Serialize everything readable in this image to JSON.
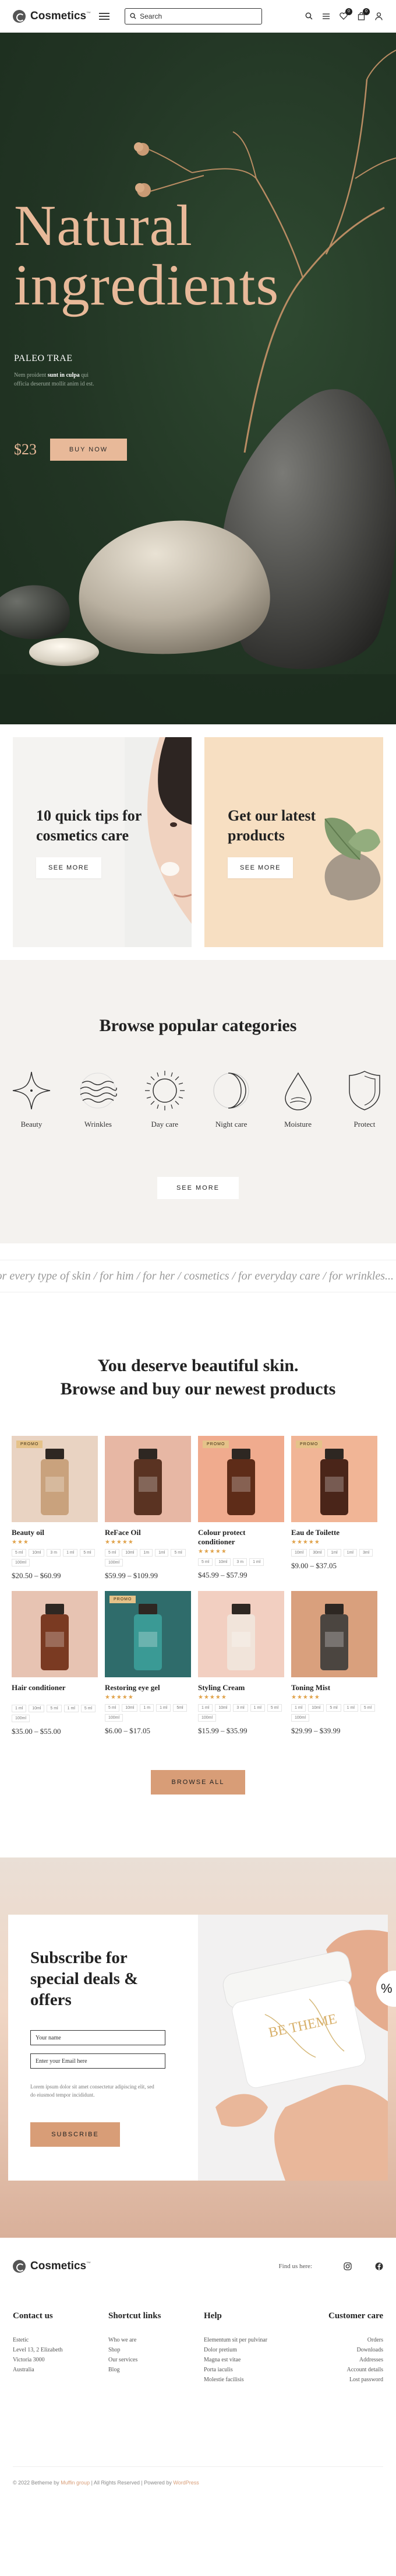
{
  "header": {
    "logo": "Cosmetics",
    "logo_tm": "™",
    "search_placeholder": "Search",
    "wishlist_count": "0",
    "cart_count": "0"
  },
  "hero": {
    "title_line1": "Natural",
    "title_line2": "ingredients",
    "subtitle": "PALEO TRAE",
    "desc_before": "Nem proident",
    "desc_bold": "sunt in culpa",
    "desc_after": "qui officia deserunt mollit anim id est.",
    "price": "$23",
    "button": "BUY NOW"
  },
  "promos": [
    {
      "title": "10 quick tips for cosmetics care",
      "button": "SEE MORE"
    },
    {
      "title": "Get our latest products",
      "button": "SEE MORE"
    }
  ],
  "categories": {
    "title": "Browse popular categories",
    "items": [
      {
        "label": "Beauty",
        "icon": "sparkle-icon"
      },
      {
        "label": "Wrinkles",
        "icon": "waves-icon"
      },
      {
        "label": "Day care",
        "icon": "sun-icon"
      },
      {
        "label": "Night care",
        "icon": "moon-icon"
      },
      {
        "label": "Moisture",
        "icon": "drop-icon"
      },
      {
        "label": "Protect",
        "icon": "shield-icon"
      }
    ],
    "button": "SEE MORE"
  },
  "marquee": "for every type of skin / for him / for her / cosmetics / for everyday care / for wrinkles...",
  "products": {
    "title_line1": "You deserve beautiful skin.",
    "title_line2": "Browse and buy our newest products",
    "items": [
      {
        "name": "Beauty oil",
        "stars": "★★★",
        "tag": "PROMO",
        "sizes": [
          "5 ml",
          "10ml",
          "3 m",
          "1 ml",
          "5 ml",
          "100ml"
        ],
        "price": "$20.50 – $60.99",
        "bg": "#e9d3c2",
        "bottle": "#c9a27d"
      },
      {
        "name": "ReFace Oil",
        "stars": "★★★★★",
        "tag": "",
        "sizes": [
          "5 ml",
          "10ml",
          "1m",
          "1ml",
          "5 ml",
          "100ml"
        ],
        "price": "$59.99 – $109.99",
        "bg": "#e7b7a4",
        "bottle": "#5a3322"
      },
      {
        "name": "Colour protect conditioner",
        "stars": "★★★★★",
        "tag": "PROMO",
        "sizes": [
          "5 ml",
          "10ml",
          "3 m",
          "1 ml"
        ],
        "price": "$45.99 – $57.99",
        "bg": "#f0ab8e",
        "bottle": "#5e2c18"
      },
      {
        "name": "Eau de Toilette",
        "stars": "★★★★★",
        "tag": "PROMO",
        "sizes": [
          "10ml",
          "30ml",
          "1ml",
          "1ml",
          "3ml"
        ],
        "price": "$9.00 – $37.05",
        "bg": "#f1b596",
        "bottle": "#4a2519"
      },
      {
        "name": "Hair conditioner",
        "stars": "",
        "tag": "",
        "sizes": [
          "1 ml",
          "10ml",
          "5 ml",
          "1 ml",
          "5 ml",
          "100ml"
        ],
        "price": "$35.00 – $55.00",
        "bg": "#e7c3b2",
        "bottle": "#7a3a22"
      },
      {
        "name": "Restoring eye gel",
        "stars": "★★★★★",
        "tag": "PROMO",
        "sizes": [
          "5 ml",
          "10ml",
          "1 m",
          "1 ml",
          "5ml",
          "100ml"
        ],
        "price": "$6.00 – $17.05",
        "bg": "#2f6c6b",
        "bottle": "#3a9a95"
      },
      {
        "name": "Styling Cream",
        "stars": "★★★★★",
        "tag": "",
        "sizes": [
          "1 ml",
          "10ml",
          "3 ml",
          "1 ml",
          "5 ml",
          "100ml"
        ],
        "price": "$15.99 – $35.99",
        "bg": "#f2cfc1",
        "bottle": "#f1e4da"
      },
      {
        "name": "Toning Mist",
        "stars": "★★★★★",
        "tag": "",
        "sizes": [
          "1 ml",
          "10ml",
          "5 ml",
          "1 ml",
          "5 ml",
          "100ml"
        ],
        "price": "$29.99 – $39.99",
        "bg": "#d9a07d",
        "bottle": "#4b4540"
      }
    ],
    "button": "BROWSE ALL"
  },
  "subscribe": {
    "title": "Subscribe for special deals & offers",
    "name_placeholder": "Your name",
    "email_placeholder": "Enter your Email here",
    "desc": "Lorem ipsum dolor sit amet consectetur adipiscing elit, sed do eiusmod tempor incididunt.",
    "button": "SUBSCRIBE",
    "jar_text": "BE THEME",
    "sale_badge": "%"
  },
  "footer": {
    "logo": "Cosmetics",
    "find_us": "Find us here:",
    "contact": {
      "title": "Contact us",
      "lines": [
        "Estetic",
        "Level 13, 2 Elizabeth",
        "Victoria 3000",
        "Australia"
      ]
    },
    "shortcut": {
      "title": "Shortcut links",
      "links": [
        "Who we are",
        "Shop",
        "Our services",
        "Blog"
      ]
    },
    "help": {
      "title": "Help",
      "links": [
        "Elementum sit per pulvinar",
        "Dolor pretium",
        "Magna est vitae",
        "Porta iaculis",
        "Molestie facilisis"
      ]
    },
    "care": {
      "title": "Customer care",
      "links": [
        "Orders",
        "Downloads",
        "Addresses",
        "Account details",
        "Lost password"
      ]
    },
    "copyright_prefix": "© 2022 Betheme by",
    "copyright_link1": "Muffin group",
    "copyright_mid": "| All Rights Reserved | Powered by",
    "copyright_link2": "WordPress"
  }
}
